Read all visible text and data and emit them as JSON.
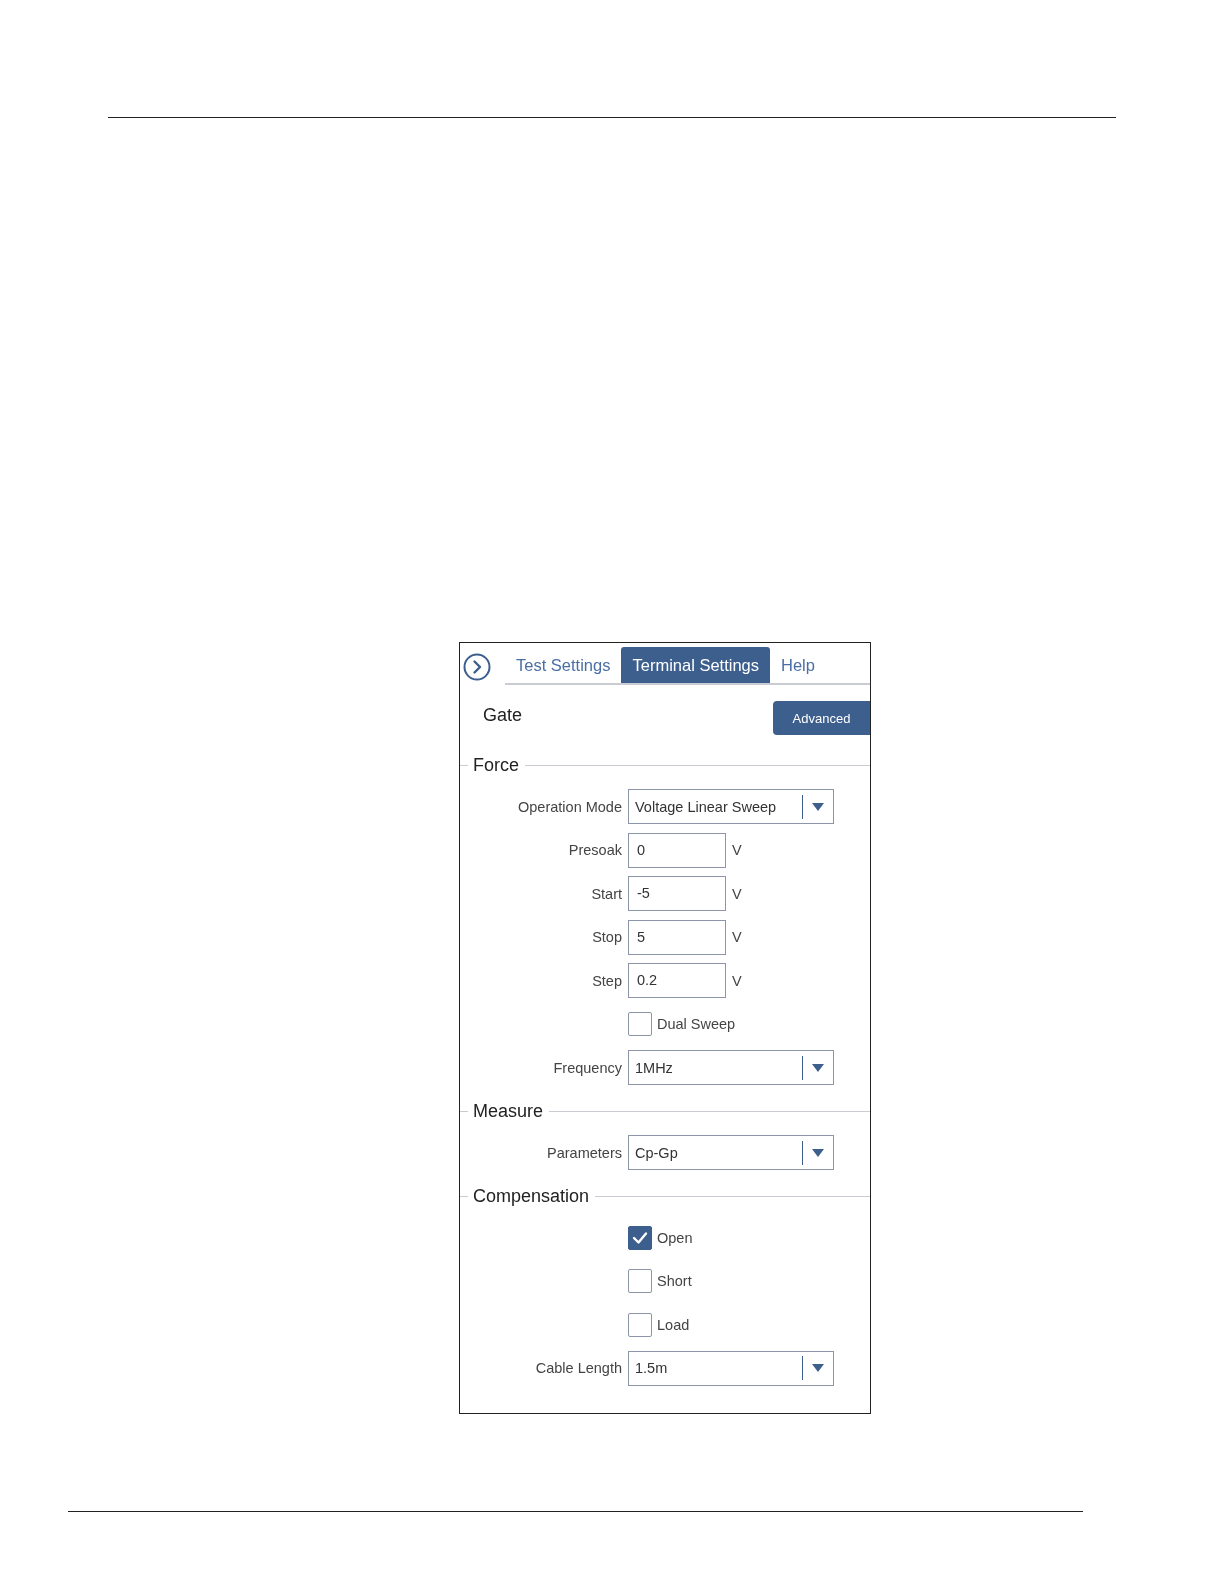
{
  "tabs": [
    {
      "label": "Test Settings",
      "selected": false
    },
    {
      "label": "Terminal Settings",
      "selected": true
    },
    {
      "label": "Help",
      "selected": false
    }
  ],
  "title": "Gate",
  "advanced_button": "Advanced",
  "sections": [
    {
      "title": "Force",
      "rows": [
        {
          "kind": "select",
          "label": "Operation Mode",
          "value": "Voltage Linear Sweep"
        },
        {
          "kind": "input",
          "label": "Presoak",
          "value": "0",
          "unit": "V"
        },
        {
          "kind": "input",
          "label": "Start",
          "value": "-5",
          "unit": "V"
        },
        {
          "kind": "input",
          "label": "Stop",
          "value": "5",
          "unit": "V"
        },
        {
          "kind": "input",
          "label": "Step",
          "value": "0.2",
          "unit": "V"
        },
        {
          "kind": "checkbox",
          "label": "Dual Sweep",
          "checked": false
        },
        {
          "kind": "select",
          "label": "Frequency",
          "value": "1MHz"
        }
      ]
    },
    {
      "title": "Measure",
      "rows": [
        {
          "kind": "select",
          "label": "Parameters",
          "value": "Cp-Gp"
        }
      ]
    },
    {
      "title": "Compensation",
      "rows": [
        {
          "kind": "checkbox",
          "label": "Open",
          "checked": true
        },
        {
          "kind": "checkbox",
          "label": "Short",
          "checked": false
        },
        {
          "kind": "checkbox",
          "label": "Load",
          "checked": false
        },
        {
          "kind": "select",
          "label": "Cable Length",
          "value": "1.5m"
        }
      ]
    }
  ]
}
